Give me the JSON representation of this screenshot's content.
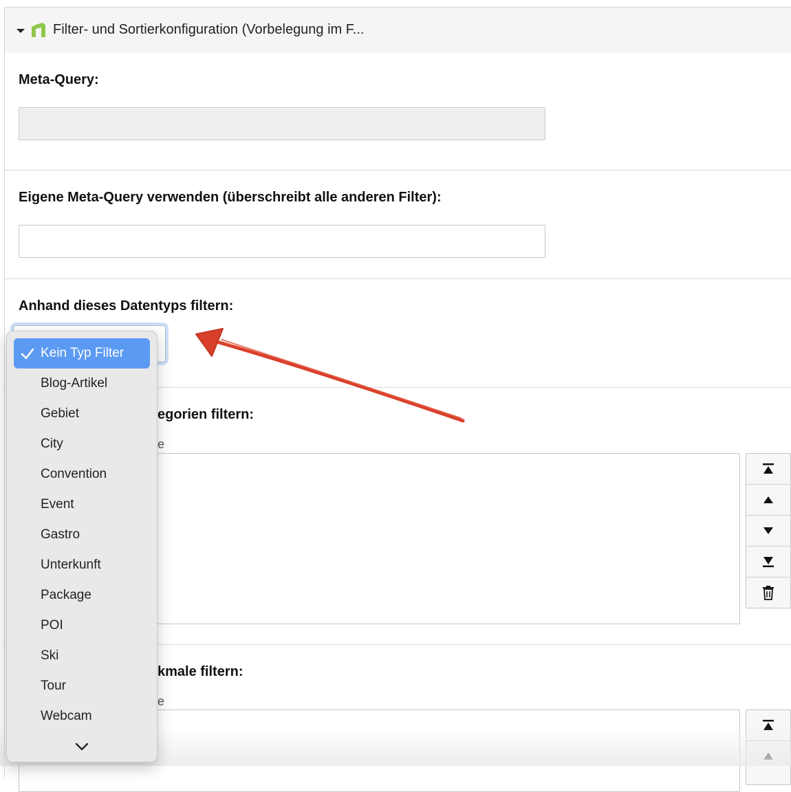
{
  "panel": {
    "title": "Filter- und Sortierkonfiguration (Vorbelegung im F...",
    "accent_color": "#8fc84a"
  },
  "meta_query": {
    "label": "Meta-Query:",
    "value": ""
  },
  "custom_meta_query": {
    "label": "Eigene Meta-Query verwenden (überschreibt alle anderen Filter):",
    "value": ""
  },
  "type_filter": {
    "label": "Anhand dieses Datentyps filtern:",
    "selected": "Kein Typ Filter",
    "options": [
      "Kein Typ Filter",
      "Blog-Artikel",
      "Gebiet",
      "City",
      "Convention",
      "Event",
      "Gastro",
      "Unterkunft",
      "Package",
      "POI",
      "Ski",
      "Tour",
      "Webcam"
    ],
    "selected_color": "#5b9af2"
  },
  "category_filter": {
    "label_visible": "egorien filtern:",
    "hint_visible": "e"
  },
  "feature_filter": {
    "label_visible": "kmale filtern:",
    "hint_visible": "e"
  },
  "list_buttons": {
    "icons": [
      "move-to-top-icon",
      "move-up-icon",
      "move-down-icon",
      "move-to-bottom-icon",
      "trash-icon"
    ]
  },
  "annotation": {
    "arrow_color": "#d9402b"
  }
}
